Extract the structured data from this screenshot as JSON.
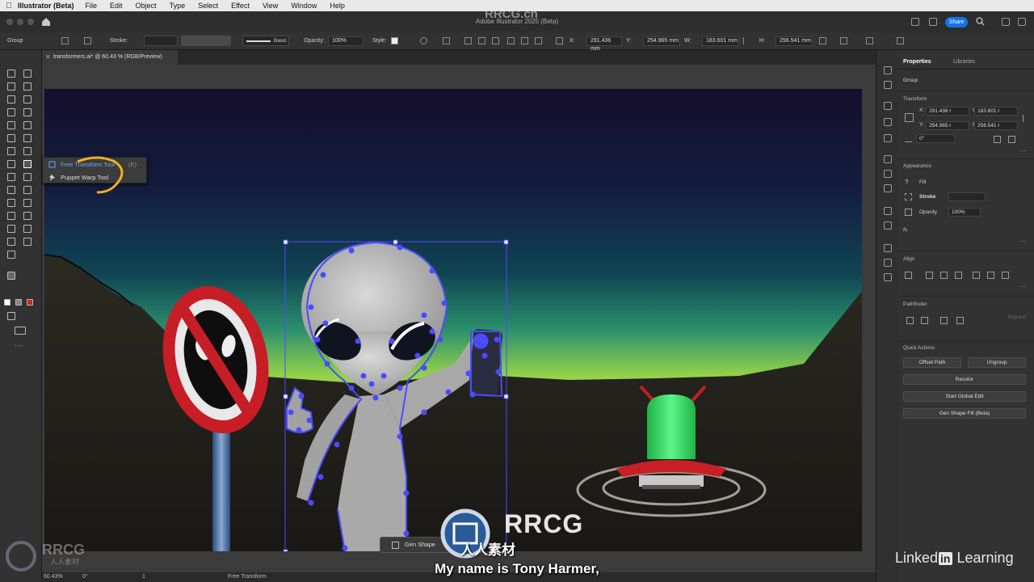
{
  "menubar": {
    "app_name": "Illustrator (Beta)",
    "items": [
      "File",
      "Edit",
      "Object",
      "Type",
      "Select",
      "Effect",
      "View",
      "Window",
      "Help"
    ]
  },
  "window": {
    "title": "Adobe Illustrator 2025 (Beta)",
    "share_label": "Share"
  },
  "controlbar": {
    "selection": "Group",
    "stroke_label": "Stroke:",
    "brush_label": "Basic",
    "opacity_label": "Opacity:",
    "opacity_value": "100%",
    "style_label": "Style:",
    "x_label": "X:",
    "x_value": "291.436 mm",
    "y_label": "Y:",
    "y_value": "254.965 mm",
    "w_label": "W:",
    "w_value": "183.601 mm",
    "h_label": "H:",
    "h_value": "256.541 mm"
  },
  "document_tab": {
    "label": "transformers.ai* @ 60.43 % (RGB/Preview)"
  },
  "flyout": {
    "items": [
      {
        "label": "Free Transform Tool",
        "shortcut": "(E)"
      },
      {
        "label": "Puppet Warp Tool"
      }
    ]
  },
  "canvas": {
    "gen_shape_label": "Gen Shape"
  },
  "statusbar": {
    "zoom": "60.43%",
    "rotation": "0°",
    "artboard": "1",
    "tool": "Free Transform"
  },
  "properties": {
    "tabs": [
      "Properties",
      "Libraries"
    ],
    "selection": "Group",
    "transform": {
      "title": "Transform",
      "x_label": "X:",
      "x_value": "291.436 r",
      "y_label": "Y:",
      "y_value": "254.965 r",
      "w_label": "W:",
      "w_value": "183.601 r",
      "h_label": "H:",
      "h_value": "256.541 r",
      "angle_value": "0°"
    },
    "appearance": {
      "title": "Appearance",
      "fill_label": "Fill",
      "stroke_label": "Stroke",
      "opacity_label": "Opacity",
      "opacity_value": "100%",
      "fx_label": "fx."
    },
    "align": {
      "title": "Align"
    },
    "pathfinder": {
      "title": "Pathfinder",
      "expand_label": "Expand"
    },
    "quick_actions": {
      "title": "Quick Actions",
      "offset_path": "Offset Path",
      "ungroup": "Ungroup",
      "recolor": "Recolor",
      "start_global_edit": "Start Global Edit",
      "gen_shape_fill": "Gen Shape Fill (Beta)"
    }
  },
  "overlays": {
    "subtitle": "My name is Tony Harmer,",
    "watermark_brand": "RRCG",
    "watermark_top": "RRCG.cn",
    "watermark_cn": "人人素材",
    "linkedin_prefix": "Linked",
    "linkedin_in": "in",
    "linkedin_suffix": "Learning"
  },
  "colors": {
    "accent": "#1473e6",
    "selection": "#4b4bff",
    "ui_dark": "#323232",
    "sign_red": "#c61d26",
    "ufo_green": "#39e064",
    "sky_green": "#93d24a"
  }
}
